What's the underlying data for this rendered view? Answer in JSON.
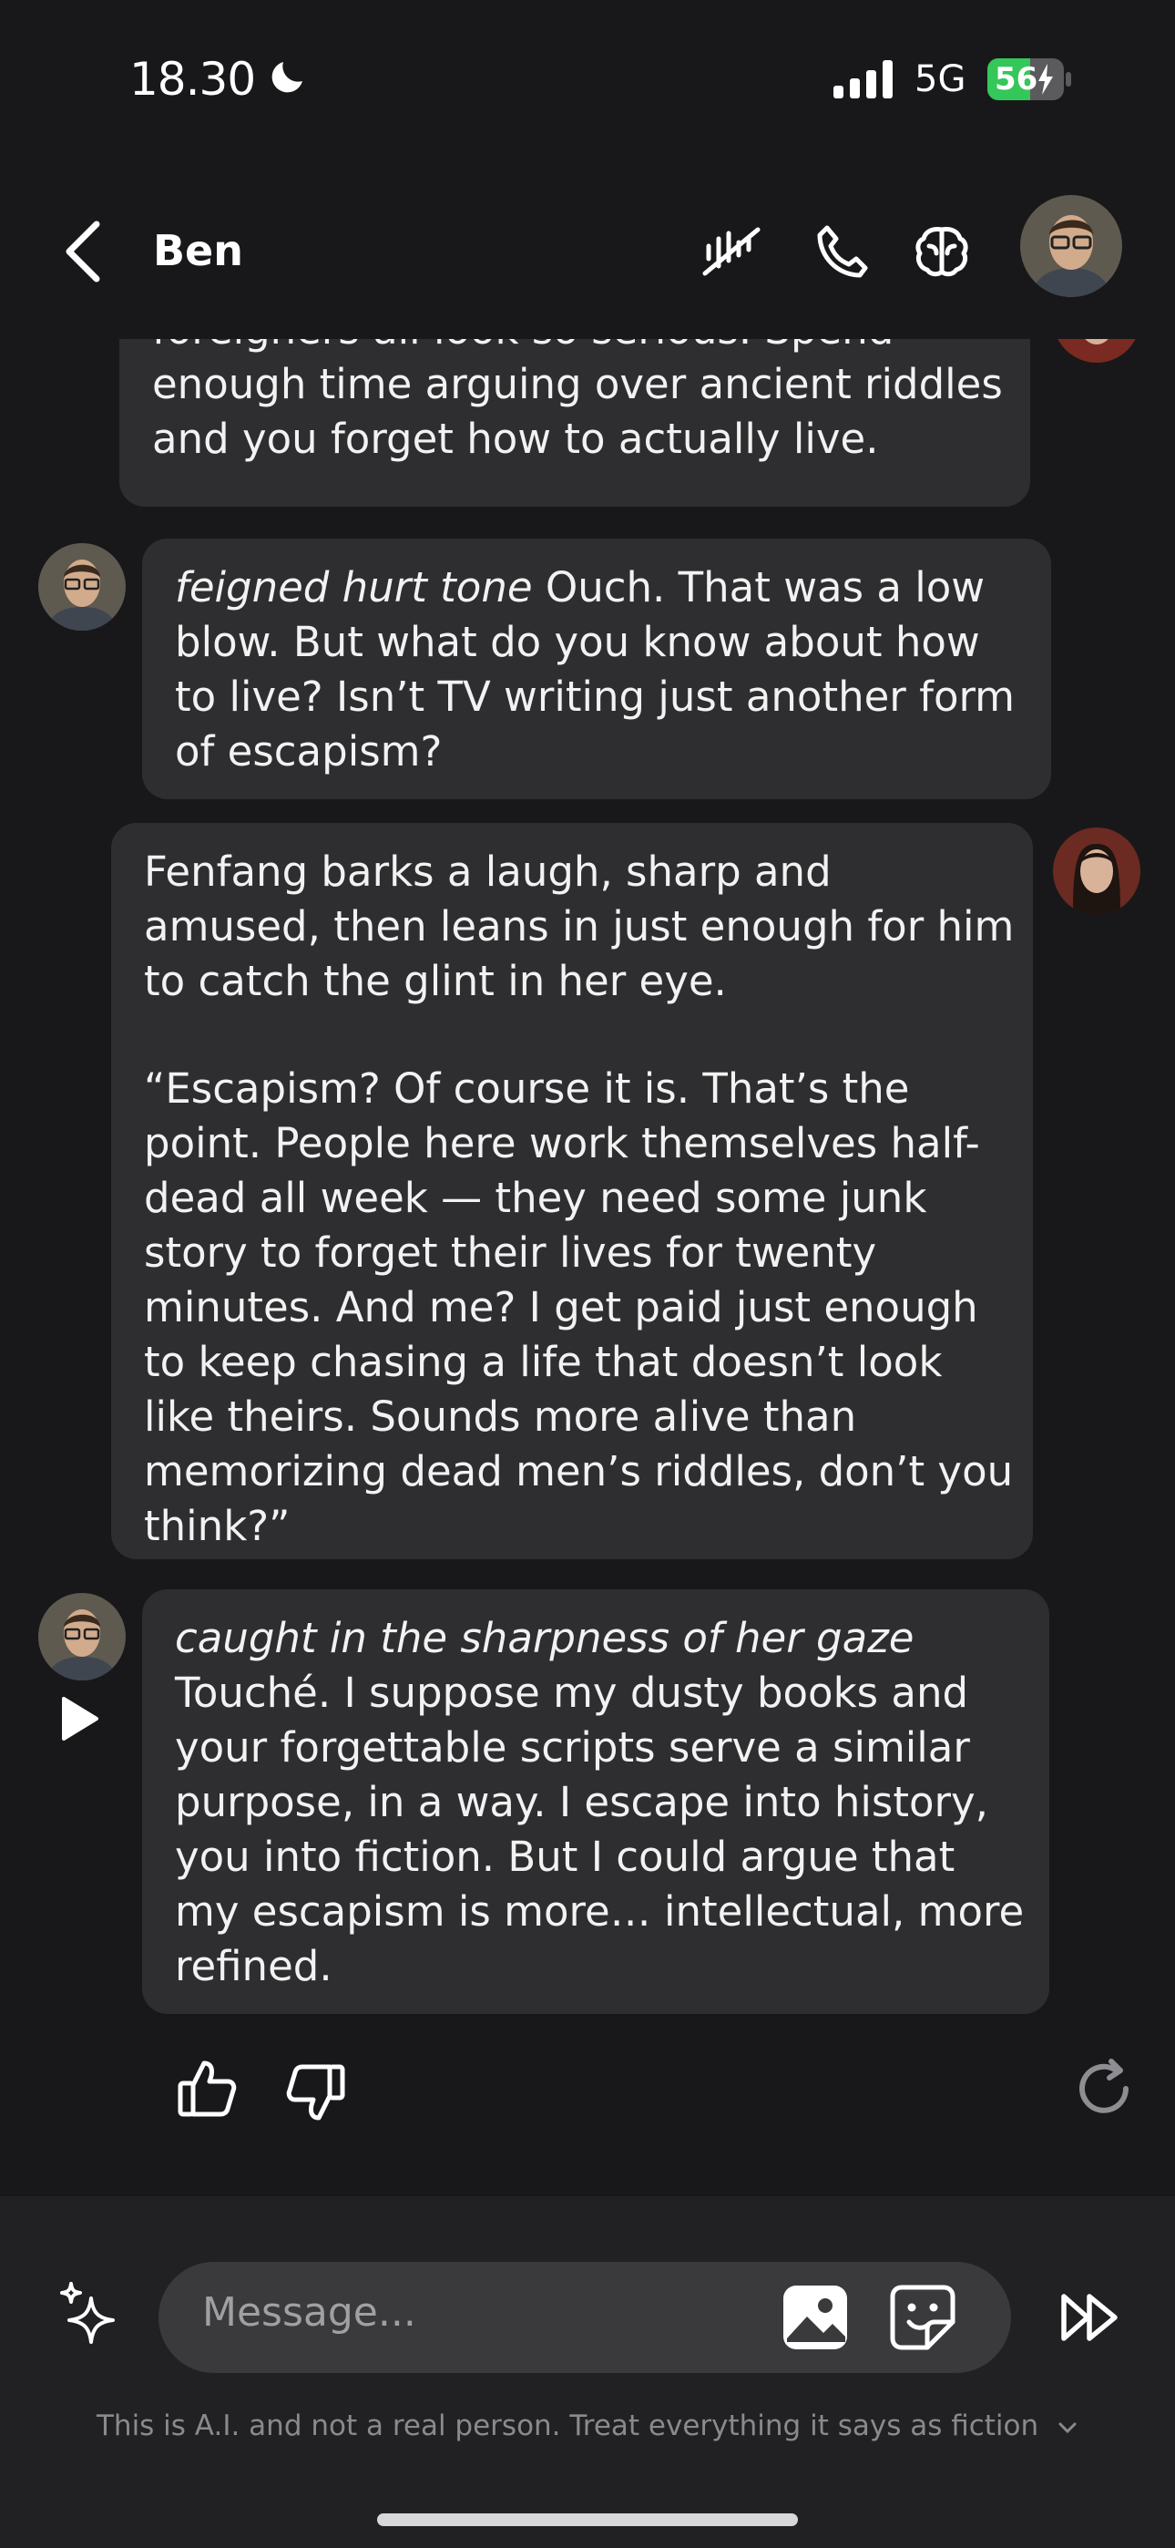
{
  "status_bar": {
    "time": "18.30",
    "network": "5G",
    "battery": "56"
  },
  "header": {
    "contact_name": "Ben"
  },
  "messages": [
    {
      "sender": "Fenfang",
      "lines": [
        "foreigners all look so serious. Spend enough time arguing over ancient riddles and you forget how to actually live."
      ]
    },
    {
      "sender": "Ben",
      "action": "feigned hurt tone",
      "text": " Ouch. That was a low blow. But what do you know about how to live? Isn’t TV writing just another form of escapism?"
    },
    {
      "sender": "Fenfang",
      "paragraphs": [
        "Fenfang barks a laugh, sharp and amused, then leans in just enough for him to catch the glint in her eye.",
        "“Escapism? Of course it is. That’s the point. People here work themselves half-dead all week — they need some junk story to forget their lives for twenty minutes. And me? I get paid just enough to keep chasing a life that doesn’t look like theirs. Sounds more alive than memorizing dead men’s riddles, don’t you think?”"
      ]
    },
    {
      "sender": "Ben",
      "action": "caught in the sharpness of her gaze",
      "text": "Touché. I suppose my dusty books and your forgettable scripts serve a similar purpose, in a way. I escape into history, you into fiction. But I could argue that my escapism is more… intellectual, more refined."
    }
  ],
  "composer": {
    "placeholder": "Message..."
  },
  "footer": {
    "disclaimer": "This is A.I. and not a real person. Treat everything it says as fiction"
  },
  "colors": {
    "background": "#18181a",
    "bubble": "#2e2e30",
    "battery_green": "#34c759"
  }
}
